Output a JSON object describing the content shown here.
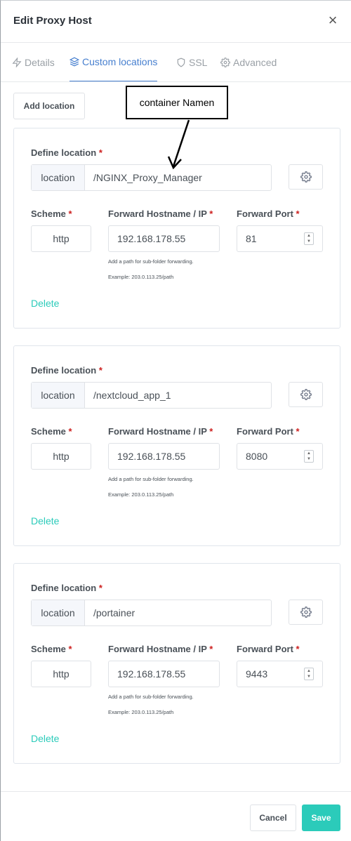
{
  "modal": {
    "title": "Edit Proxy Host",
    "close_glyph": "×"
  },
  "tabs": [
    {
      "label": "Details",
      "icon": "zap-icon"
    },
    {
      "label": "Custom locations",
      "icon": "layers-icon",
      "active": true
    },
    {
      "label": "SSL",
      "icon": "shield-icon"
    },
    {
      "label": "Advanced",
      "icon": "gear-icon"
    }
  ],
  "add_location_label": "Add location",
  "annotation": {
    "text": "container Namen"
  },
  "field_labels": {
    "define_location": "Define location",
    "scheme": "Scheme",
    "forward_host": "Forward Hostname / IP",
    "forward_port": "Forward Port",
    "required_mark": "*"
  },
  "locations": [
    {
      "addon": "location",
      "path": "/NGINX_Proxy_Manager",
      "scheme": "http",
      "host": "192.168.178.55",
      "port": "81",
      "hint1": "Add a path for sub-folder forwarding.",
      "hint2": "Example: 203.0.113.25/path",
      "delete_label": "Delete"
    },
    {
      "addon": "location",
      "path": "/nextcloud_app_1",
      "scheme": "http",
      "host": "192.168.178.55",
      "port": "8080",
      "hint1": "Add a path for sub-folder forwarding.",
      "hint2": "Example: 203.0.113.25/path",
      "delete_label": "Delete"
    },
    {
      "addon": "location",
      "path": "/portainer",
      "scheme": "http",
      "host": "192.168.178.55",
      "port": "9443",
      "hint1": "Add a path for sub-folder forwarding.",
      "hint2": "Example: 203.0.113.25/path",
      "delete_label": "Delete"
    }
  ],
  "footer": {
    "cancel_label": "Cancel",
    "save_label": "Save"
  },
  "colors": {
    "accent": "#467fcf",
    "teal": "#2bcbba",
    "required": "#cd201f"
  }
}
